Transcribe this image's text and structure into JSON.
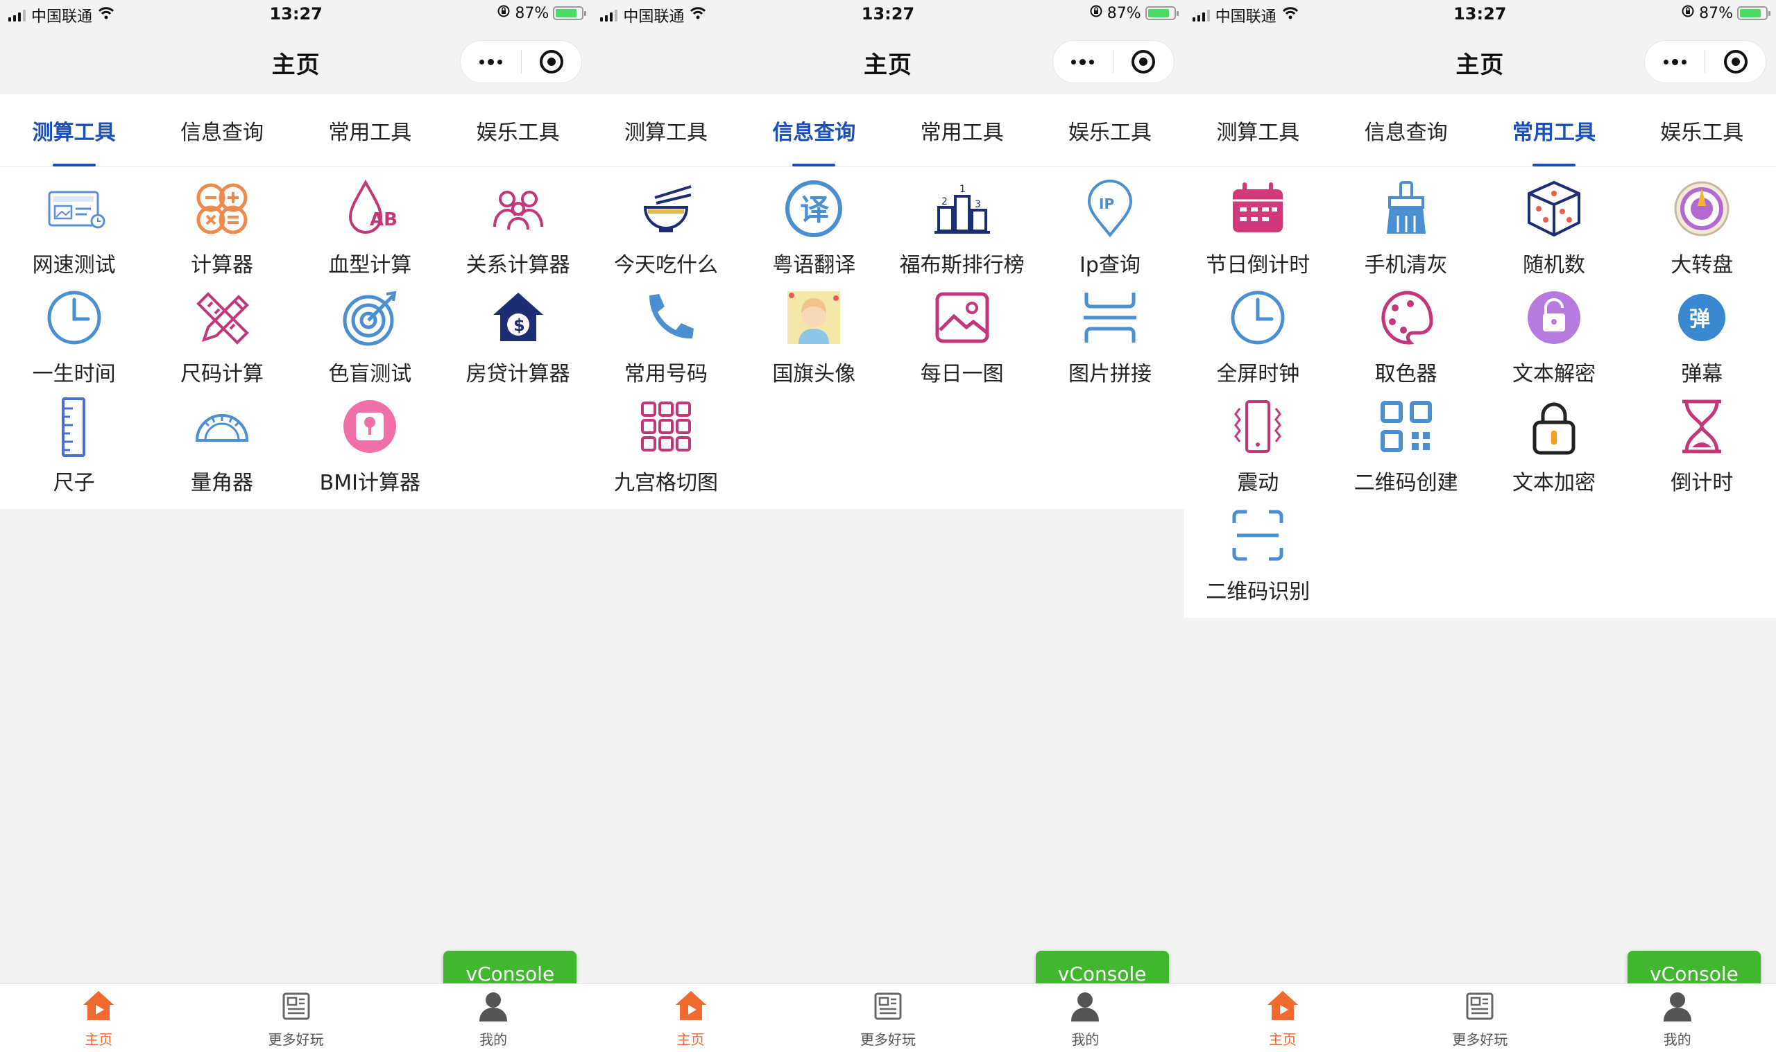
{
  "status": {
    "carrier": "中国联通",
    "time": "13:27",
    "battery": "87%"
  },
  "nav": {
    "title": "主页"
  },
  "tabs": [
    "测算工具",
    "信息查询",
    "常用工具",
    "娱乐工具"
  ],
  "vconsole": "vConsole",
  "tabbar": [
    "主页",
    "更多好玩",
    "我的"
  ],
  "colors": {
    "accent": "#1d4fb8",
    "tabbar_active": "#ef6a2c",
    "vconsole": "#41b730"
  },
  "screens": [
    {
      "active_tab": 0,
      "items": [
        {
          "label": "网速测试",
          "icon": "speedtest-icon"
        },
        {
          "label": "计算器",
          "icon": "calculator-icon"
        },
        {
          "label": "血型计算",
          "icon": "blood-type-icon"
        },
        {
          "label": "关系计算器",
          "icon": "relatives-icon"
        },
        {
          "label": "一生时间",
          "icon": "clock-icon"
        },
        {
          "label": "尺码计算",
          "icon": "ruler-pencil-icon"
        },
        {
          "label": "色盲测试",
          "icon": "target-icon"
        },
        {
          "label": "房贷计算器",
          "icon": "house-dollar-icon"
        },
        {
          "label": "尺子",
          "icon": "ruler-icon"
        },
        {
          "label": "量角器",
          "icon": "protractor-icon"
        },
        {
          "label": "BMI计算器",
          "icon": "scale-icon"
        }
      ]
    },
    {
      "active_tab": 1,
      "items": [
        {
          "label": "今天吃什么",
          "icon": "bowl-icon"
        },
        {
          "label": "粤语翻译",
          "icon": "translate-icon"
        },
        {
          "label": "福布斯排行榜",
          "icon": "podium-icon"
        },
        {
          "label": "Ip查询",
          "icon": "ip-pin-icon"
        },
        {
          "label": "常用号码",
          "icon": "phone-icon"
        },
        {
          "label": "国旗头像",
          "icon": "avatar-flag-icon"
        },
        {
          "label": "每日一图",
          "icon": "picture-icon"
        },
        {
          "label": "图片拼接",
          "icon": "stitch-icon"
        },
        {
          "label": "九宫格切图",
          "icon": "grid-nine-icon"
        }
      ]
    },
    {
      "active_tab": 2,
      "items": [
        {
          "label": "节日倒计时",
          "icon": "calendar-icon"
        },
        {
          "label": "手机清灰",
          "icon": "brush-icon"
        },
        {
          "label": "随机数",
          "icon": "dice-icon"
        },
        {
          "label": "大转盘",
          "icon": "wheel-icon"
        },
        {
          "label": "全屏时钟",
          "icon": "clock-icon"
        },
        {
          "label": "取色器",
          "icon": "palette-icon"
        },
        {
          "label": "文本解密",
          "icon": "unlock-icon"
        },
        {
          "label": "弹幕",
          "icon": "danmu-icon"
        },
        {
          "label": "震动",
          "icon": "vibrate-icon"
        },
        {
          "label": "二维码创建",
          "icon": "qrcode-icon"
        },
        {
          "label": "文本加密",
          "icon": "lock-icon"
        },
        {
          "label": "倒计时",
          "icon": "hourglass-icon"
        },
        {
          "label": "二维码识别",
          "icon": "scan-icon"
        }
      ]
    }
  ]
}
